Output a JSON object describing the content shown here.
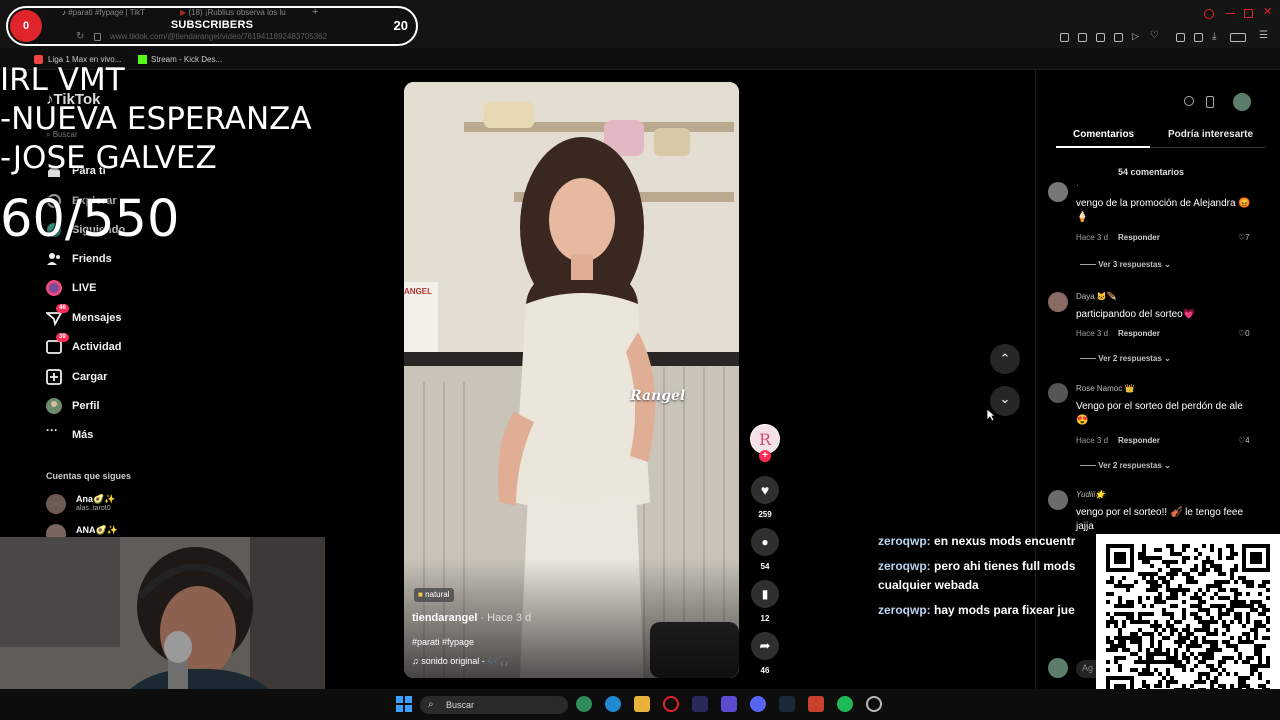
{
  "browser": {
    "tabs": [
      {
        "label": "#parati #fypage | TikT"
      },
      {
        "label": "(18) ¡Rublius observa los lu"
      }
    ],
    "url": "www.tiktok.com/@tiendarangel/video/7619411892483705362",
    "bookmarks": [
      {
        "label": "Liga 1 Max en vivo..."
      },
      {
        "label": "Stream - Kick Des..."
      }
    ]
  },
  "stream": {
    "subscriber_label": "SUBSCRIBERS",
    "subscriber_count": "20",
    "record_glyph": "0",
    "overlay_lines": [
      "IRL VMT",
      "-NUEVA ESPERANZA",
      "-JOSE GALVEZ"
    ],
    "counter": "60/550",
    "chat": [
      {
        "user": "zeroqwp:",
        "text": "en nexus mods encuentr",
        "cont": ""
      },
      {
        "user": "zeroqwp:",
        "text": "pero ahi tienes full mods",
        "cont": "cualquier webada"
      },
      {
        "user": "zeroqwp:",
        "text": "hay mods para fixear jue",
        "cont": ""
      }
    ]
  },
  "tiktok": {
    "logo": "TikTok",
    "search_placeholder": "Buscar",
    "nav": [
      {
        "label": "Para ti",
        "icon": "home-icon"
      },
      {
        "label": "Explorar",
        "icon": "compass-icon"
      },
      {
        "label": "Siguiendo",
        "icon": "following-icon"
      },
      {
        "label": "Friends",
        "icon": "friends-icon"
      },
      {
        "label": "LIVE",
        "icon": "live-icon"
      },
      {
        "label": "Mensajes",
        "icon": "message-icon",
        "badge": "46"
      },
      {
        "label": "Actividad",
        "icon": "activity-icon",
        "badge": "39"
      },
      {
        "label": "Cargar",
        "icon": "upload-icon"
      },
      {
        "label": "Perfil",
        "icon": "avatar-icon"
      },
      {
        "label": "Más",
        "icon": "more-icon"
      }
    ],
    "following_title": "Cuentas que sigues",
    "following": [
      {
        "name": "Ana🥑✨",
        "handle": "alas..tarot0"
      },
      {
        "name": "ANA🥑✨",
        "handle": ""
      }
    ],
    "video": {
      "sign_text": "Rangel",
      "left_sign": "ANGEL",
      "tag": "natural",
      "author": "tiendarangel",
      "age": " · Hace 3 d",
      "hashtags": "#parati #fypage",
      "sound": "sonido original - 🎶🎧"
    },
    "actions": {
      "likes": "259",
      "comments": "54",
      "saves": "12",
      "shares": "46"
    },
    "panel_tabs": [
      "Comentarios",
      "Podría interesarte"
    ],
    "comment_count_label": "54 comentarios",
    "comments": [
      {
        "name": "·",
        "text": "vengo de la promoción de Alejandra 😡🍦",
        "time": "Hace 3 d",
        "reply": "Responder",
        "likes": "7",
        "more": "Ver 3 respuestas"
      },
      {
        "name": "Daya 🐱🪶",
        "text": "participandoo del sorteo💗",
        "time": "Hace 3 d",
        "reply": "Responder",
        "likes": "0",
        "more": "Ver 2 respuestas"
      },
      {
        "name": "Rose Namoc 👑",
        "text": "Vengo por el sorteo del perdón de ale 😍",
        "time": "Hace 3 d",
        "reply": "Responder",
        "likes": "4",
        "more": "Ver 2 respuestas"
      },
      {
        "name": "Yudiii🌟",
        "text": "vengo por el sorteo!! 🎻 le tengo feee jajja",
        "time": "",
        "reply": "",
        "likes": "",
        "more": ""
      }
    ],
    "add_comment_placeholder": "Ag"
  },
  "taskbar": {
    "search_label": "Buscar"
  },
  "colors": {
    "accent": "#fe2c55",
    "record": "#e0242b",
    "chat_user": "#b9d3f0"
  }
}
